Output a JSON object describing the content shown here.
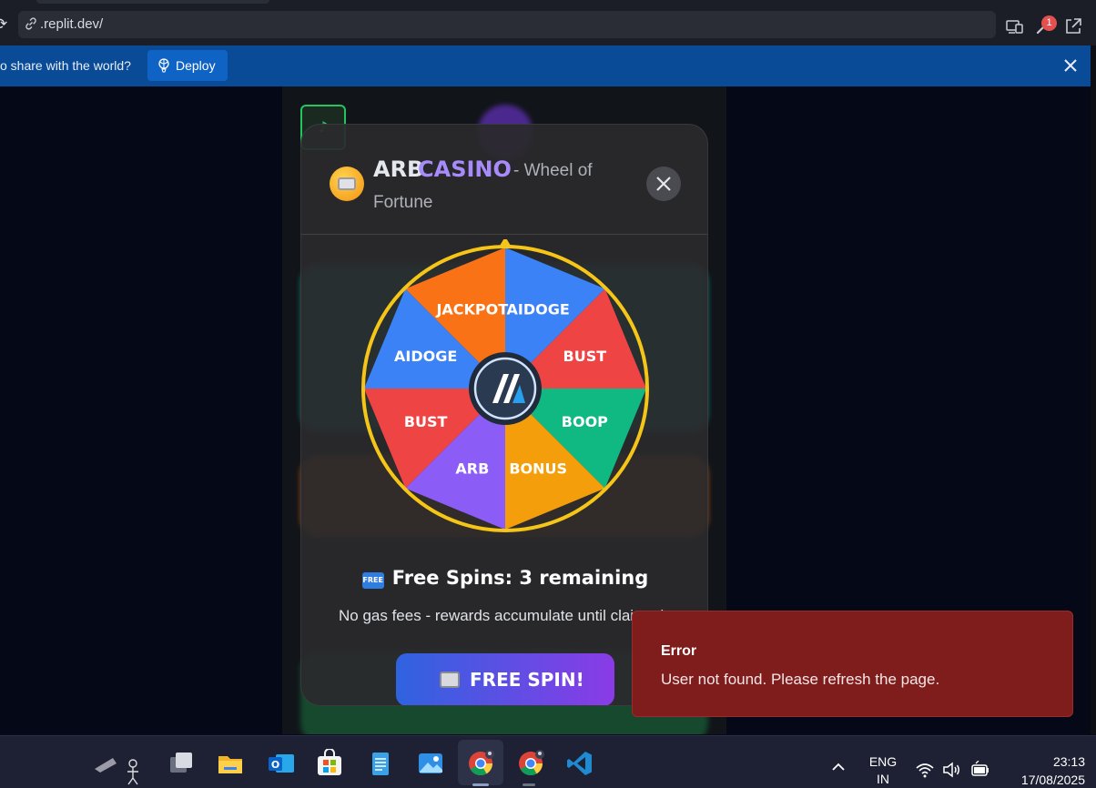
{
  "browser": {
    "url": ".replit.dev/",
    "notification_count": "1"
  },
  "banner": {
    "text": "o share with the world?",
    "deploy_label": "Deploy"
  },
  "modal": {
    "brand_arb": "ARB",
    "brand_casino": "CASINO",
    "subtitle_line1": "- Wheel of",
    "subtitle_line2": "Fortune",
    "wheel_segments": [
      "AIDOGE",
      "BUST",
      "BOOP",
      "BONUS",
      "ARB",
      "BUST",
      "AIDOGE",
      "JACKPOT"
    ],
    "wheel_colors": [
      "#3b82f6",
      "#ef4444",
      "#10b981",
      "#f59e0b",
      "#8b5cf6",
      "#ef4444",
      "#3b82f6",
      "#f97316"
    ],
    "free_spins_text": "Free Spins: 3 remaining",
    "free_badge": "FREE",
    "gas_note": "No gas fees - rewards accumulate until claimed",
    "spin_button": "FREE SPIN!"
  },
  "music": {
    "icon": "♪"
  },
  "toast": {
    "title": "Error",
    "message": "User not found. Please refresh the page."
  },
  "taskbar": {
    "lang_line1": "ENG",
    "lang_line2": "IN",
    "time": "23:13",
    "date": "17/08/2025"
  },
  "colors": {
    "banner": "#0a4b97",
    "toast": "#7f1d1d",
    "accent_purple": "#a78bfa",
    "wheel_rim": "#f5c518"
  }
}
